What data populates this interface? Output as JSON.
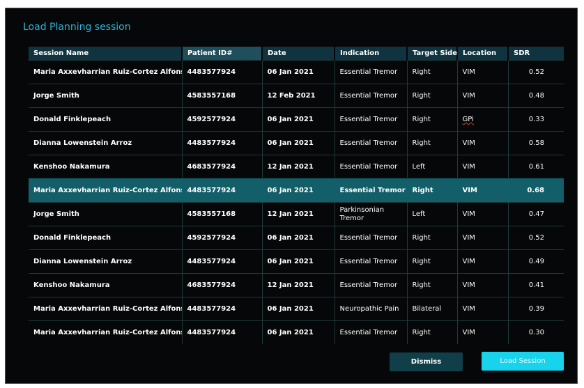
{
  "dialog": {
    "title": "Load Planning session",
    "dismiss_label": "Dismiss",
    "load_label": "Load Session"
  },
  "table": {
    "headers": [
      "Session Name",
      "Patient ID#",
      "Date",
      "Indication",
      "Target Side",
      "Location",
      "SDR"
    ],
    "rows": [
      [
        "Maria Axxevharrian Ruiz-Cortez Alfonso",
        "4483577924",
        "06 Jan 2021",
        "Essential Tremor",
        "Right",
        "VIM",
        "0.52"
      ],
      [
        "Jorge Smith",
        "4583557168",
        "12 Feb 2021",
        "Essential Tremor",
        "Right",
        "VIM",
        "0.48"
      ],
      [
        "Donald Finklepeach",
        "4592577924",
        "06 Jan 2021",
        "Essential Tremor",
        "Right",
        "GPi",
        "0.33"
      ],
      [
        "Dianna Lowenstein Arroz",
        "4483577924",
        "06 Jan 2021",
        "Essential Tremor",
        "Right",
        "VIM",
        "0.58"
      ],
      [
        "Kenshoo Nakamura",
        "4683577924",
        "12 Jan 2021",
        "Essential Tremor",
        "Left",
        "VIM",
        "0.61"
      ],
      [
        "Maria Axxevharrian Ruiz-Cortez Alfonso",
        "4483577924",
        "06 Jan 2021",
        "Essential Tremor",
        "Right",
        "VIM",
        "0.68"
      ],
      [
        "Jorge Smith",
        "4583557168",
        "12 Jan 2021",
        "Parkinsonian Tremor",
        "Left",
        "VIM",
        "0.47"
      ],
      [
        "Donald Finklepeach",
        "4592577924",
        "06 Jan 2021",
        "Essential Tremor",
        "Right",
        "VIM",
        "0.52"
      ],
      [
        "Dianna Lowenstein Arroz",
        "4483577924",
        "06 Jan 2021",
        "Essential Tremor",
        "Right",
        "VIM",
        "0.49"
      ],
      [
        "Kenshoo Nakamura",
        "4683577924",
        "12 Jan 2021",
        "Essential Tremor",
        "Right",
        "VIM",
        "0.41"
      ],
      [
        "Maria Axxevharrian Ruiz-Cortez Alfonso",
        "4483577924",
        "06 Jan 2021",
        "Neuropathic Pain",
        "Bilateral",
        "VIM",
        "0.39"
      ],
      [
        "Maria Axxevharrian Ruiz-Cortez Alfonso",
        "4483577924",
        "06 Jan 2021",
        "Essential Tremor",
        "Right",
        "VIM",
        "0.30"
      ]
    ],
    "selected_row": 5
  },
  "colors": {
    "accent": "#17d3ec",
    "header_bg": "#0f3440",
    "selected_row_bg": "#125e69",
    "dialog_bg": "#060708"
  }
}
